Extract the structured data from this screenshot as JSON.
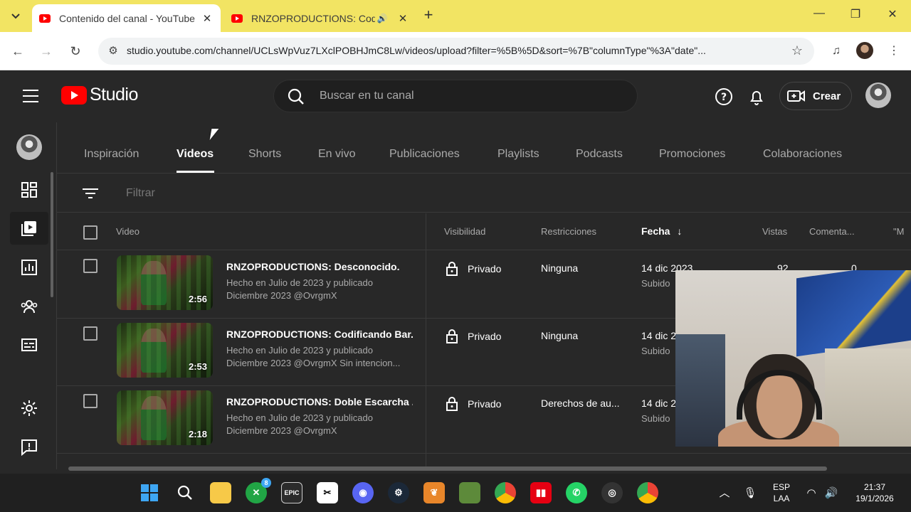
{
  "browser": {
    "tabs": [
      {
        "title": "Contenido del canal - YouTube",
        "active": true
      },
      {
        "title": "RNZOPRODUCTIONS: Codi",
        "active": false,
        "audio": true
      }
    ],
    "url": "studio.youtube.com/channel/UCLsWpVuz7LXclPOBHJmC8Lw/videos/upload?filter=%5B%5D&sort=%7B\"columnType\"%3A\"date\"..."
  },
  "studio": {
    "logo_text": "Studio",
    "search_placeholder": "Buscar en tu canal",
    "create_label": "Crear"
  },
  "content_tabs": [
    "Inspiración",
    "Videos",
    "Shorts",
    "En vivo",
    "Publicaciones",
    "Playlists",
    "Podcasts",
    "Promociones",
    "Colaboraciones"
  ],
  "active_tab": "Videos",
  "filter_placeholder": "Filtrar",
  "columns": {
    "video": "Video",
    "visibility": "Visibilidad",
    "restrictions": "Restricciones",
    "date": "Fecha",
    "views": "Vistas",
    "comments": "Comenta...",
    "more": "\"M"
  },
  "videos": [
    {
      "title": "RNZOPRODUCTIONS: Desconocido.",
      "description": "Hecho en Julio de 2023 y publicado Diciembre 2023 @OvrgmX",
      "duration": "2:56",
      "visibility": "Privado",
      "restrictions": "Ninguna",
      "date": "14 dic 2023",
      "date_sub": "Subido",
      "views": "92",
      "comments": "0"
    },
    {
      "title": "RNZOPRODUCTIONS: Codificando Bar...",
      "description": "Hecho en Julio de 2023 y publicado Diciembre 2023 @OvrgmX Sin intencion...",
      "duration": "2:53",
      "visibility": "Privado",
      "restrictions": "Ninguna",
      "date": "14 dic 2",
      "date_sub": "Subido",
      "views": "",
      "comments": ""
    },
    {
      "title": "RNZOPRODUCTIONS: Doble Escarcha ...",
      "description": "Hecho en Julio de 2023 y publicado Diciembre 2023 @OvrgmX",
      "duration": "2:18",
      "visibility": "Privado",
      "restrictions": "Derechos de au...",
      "date": "14 dic 2",
      "date_sub": "Subido",
      "views": "",
      "comments": ""
    }
  ],
  "taskbar": {
    "badge_count": "8",
    "language": "ESP",
    "layout": "LAA",
    "time": "21:37",
    "date": "19/1/2026"
  },
  "colors": {
    "accent_red": "#ff0000",
    "tabstrip": "#f2e463",
    "studio_bg": "#282828"
  }
}
